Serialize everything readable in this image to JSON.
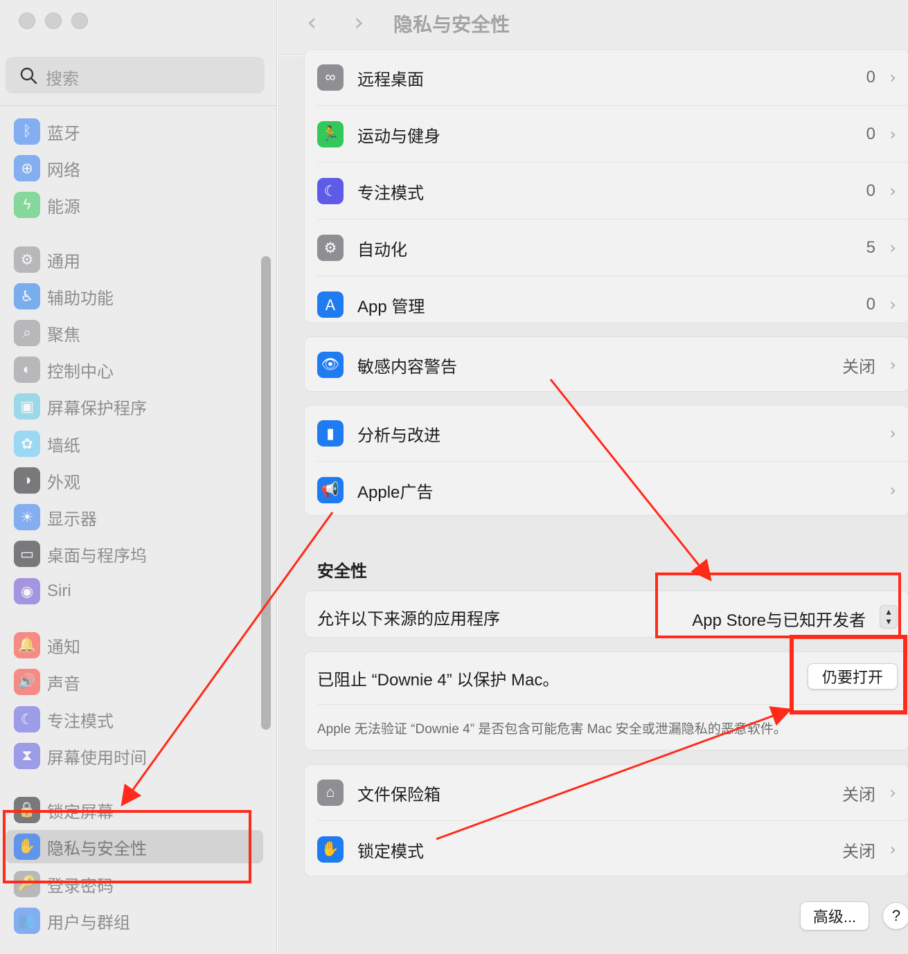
{
  "window": {
    "title": "隐私与安全性",
    "back_glyph": "‹",
    "forward_glyph": "›"
  },
  "search": {
    "placeholder": "搜索"
  },
  "sidebar": {
    "items": [
      {
        "label": "蓝牙",
        "icon": "bluetooth-icon",
        "color": "#2f7cf6",
        "glyph": "ᛒ"
      },
      {
        "label": "网络",
        "icon": "globe-icon",
        "color": "#2f7cf6",
        "glyph": "⊕"
      },
      {
        "label": "能源",
        "icon": "battery-bolt-icon",
        "color": "#34c759",
        "glyph": "ϟ"
      },
      {
        "label": "通用",
        "icon": "gear-icon",
        "color": "#8e8e93",
        "glyph": "⚙"
      },
      {
        "label": "辅助功能",
        "icon": "accessibility-icon",
        "color": "#1e7bf0",
        "glyph": "♿"
      },
      {
        "label": "聚焦",
        "icon": "spotlight-icon",
        "color": "#8e8e93",
        "glyph": "⌕"
      },
      {
        "label": "控制中心",
        "icon": "toggles-icon",
        "color": "#8e8e93",
        "glyph": "◐"
      },
      {
        "label": "屏幕保护程序",
        "icon": "screensaver-icon",
        "color": "#5ac8e6",
        "glyph": "▣"
      },
      {
        "label": "墙纸",
        "icon": "flower-icon",
        "color": "#5ac8fa",
        "glyph": "✿"
      },
      {
        "label": "外观",
        "icon": "appearance-icon",
        "color": "#1d1d1f",
        "glyph": "◑"
      },
      {
        "label": "显示器",
        "icon": "sun-icon",
        "color": "#2f7cf6",
        "glyph": "☀"
      },
      {
        "label": "桌面与程序坞",
        "icon": "dock-icon",
        "color": "#1d1d1f",
        "glyph": "▭"
      },
      {
        "label": "Siri",
        "icon": "siri-icon",
        "color": "#6b4fd8",
        "glyph": "◉"
      },
      {
        "label": "通知",
        "icon": "bell-icon",
        "color": "#ff3b30",
        "glyph": "🔔"
      },
      {
        "label": "声音",
        "icon": "speaker-icon",
        "color": "#ff3b30",
        "glyph": "🔊"
      },
      {
        "label": "专注模式",
        "icon": "moon-icon",
        "color": "#5e5ce6",
        "glyph": "☾"
      },
      {
        "label": "屏幕使用时间",
        "icon": "hourglass-icon",
        "color": "#5e5ce6",
        "glyph": "⧗"
      },
      {
        "label": "锁定屏幕",
        "icon": "lock-screen-icon",
        "color": "#1d1d1f",
        "glyph": "🔒"
      },
      {
        "label": "隐私与安全性",
        "icon": "hand-icon",
        "color": "#2f7cf6",
        "glyph": "✋"
      },
      {
        "label": "登录密码",
        "icon": "password-lock-icon",
        "color": "#8e8e93",
        "glyph": "🔑"
      },
      {
        "label": "用户与群组",
        "icon": "users-icon",
        "color": "#2f7cf6",
        "glyph": "👥"
      }
    ]
  },
  "privacy_rows": [
    {
      "label": "远程桌面",
      "value": "0",
      "icon": "binoculars-icon",
      "color": "#8e8e93",
      "glyph": "∞"
    },
    {
      "label": "运动与健身",
      "value": "0",
      "icon": "running-figure-icon",
      "color": "#34c759",
      "glyph": "🏃"
    },
    {
      "label": "专注模式",
      "value": "0",
      "icon": "moon-icon",
      "color": "#5e5ce6",
      "glyph": "☾"
    },
    {
      "label": "自动化",
      "value": "5",
      "icon": "gears-icon",
      "color": "#8e8e93",
      "glyph": "⚙"
    },
    {
      "label": "App 管理",
      "value": "0",
      "icon": "app-store-icon",
      "color": "#1e7bf0",
      "glyph": "Ａ"
    }
  ],
  "sensitive_row": {
    "label": "敏感内容警告",
    "value": "关闭",
    "icon": "eye-warning-icon",
    "color": "#1e7bf0",
    "glyph": "👁"
  },
  "analytics_rows": [
    {
      "label": "分析与改进",
      "value": "",
      "icon": "bar-chart-icon",
      "color": "#1e7bf0",
      "glyph": "▮"
    },
    {
      "label": "Apple广告",
      "value": "",
      "icon": "megaphone-icon",
      "color": "#1e7bf0",
      "glyph": "📢"
    }
  ],
  "security": {
    "heading": "安全性",
    "allow_label": "允许以下来源的应用程序",
    "allow_value": "App Store与已知开发者",
    "blocked_title": "已阻止 “Downie 4” 以保护 Mac。",
    "open_button": "仍要打开",
    "blocked_desc": "Apple 无法验证 “Downie 4” 是否包含可能危害 Mac 安全或泄漏隐私的恶意软件。"
  },
  "bottom_rows": [
    {
      "label": "文件保险箱",
      "value": "关闭",
      "icon": "filevault-house-icon",
      "color": "#8e8e93",
      "glyph": "⌂"
    },
    {
      "label": "锁定模式",
      "value": "关闭",
      "icon": "hand-icon",
      "color": "#1e7bf0",
      "glyph": "✋"
    }
  ],
  "footer": {
    "advanced_button": "高级...",
    "help_button": "?"
  },
  "annotation_color": "#ff2a1a",
  "chevron": "›"
}
